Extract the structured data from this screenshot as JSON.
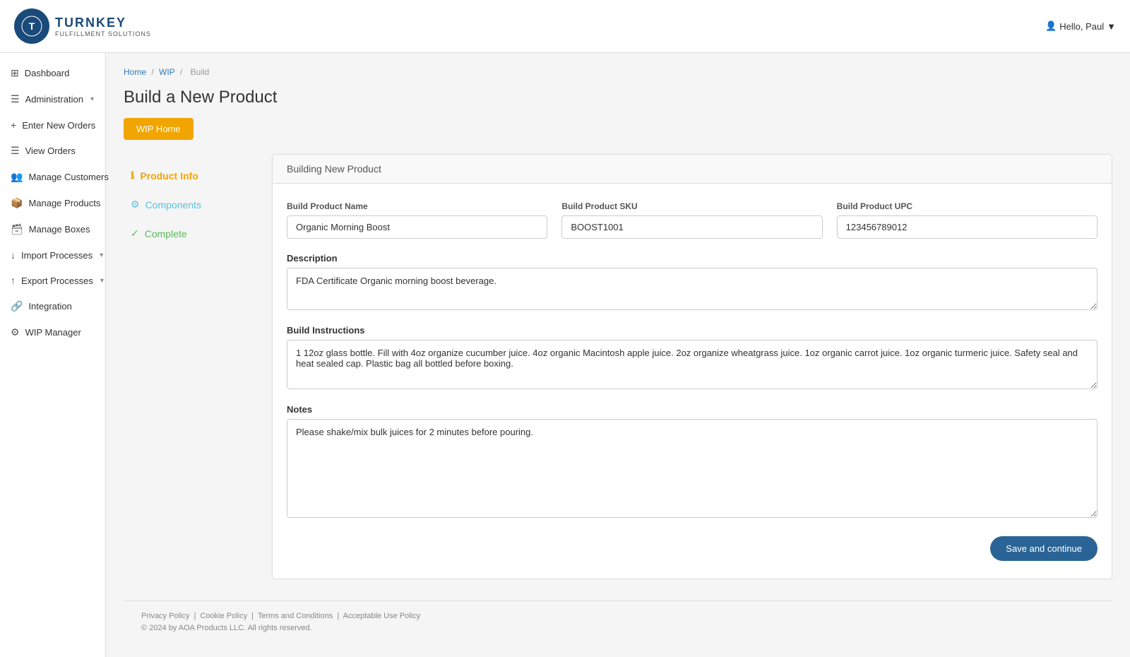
{
  "topbar": {
    "logo_letter": "T",
    "logo_title": "TURNKEY",
    "logo_subtitle": "FULFILLMENT SOLUTIONS",
    "user_label": "Hello, Paul",
    "user_arrow": "▼"
  },
  "sidebar": {
    "items": [
      {
        "id": "dashboard",
        "label": "Dashboard",
        "icon": "⊞",
        "has_arrow": false
      },
      {
        "id": "administration",
        "label": "Administration",
        "icon": "☰",
        "has_arrow": true
      },
      {
        "id": "enter-orders",
        "label": "Enter New Orders",
        "icon": "+",
        "has_arrow": false
      },
      {
        "id": "view-orders",
        "label": "View Orders",
        "icon": "☰",
        "has_arrow": false
      },
      {
        "id": "manage-customers",
        "label": "Manage Customers",
        "icon": "👥",
        "has_arrow": false
      },
      {
        "id": "manage-products",
        "label": "Manage Products",
        "icon": "📦",
        "has_arrow": false
      },
      {
        "id": "manage-boxes",
        "label": "Manage Boxes",
        "icon": "🗃",
        "has_arrow": false
      },
      {
        "id": "import-processes",
        "label": "Import Processes",
        "icon": "↓",
        "has_arrow": true
      },
      {
        "id": "export-processes",
        "label": "Export Processes",
        "icon": "↑",
        "has_arrow": true
      },
      {
        "id": "integration",
        "label": "Integration",
        "icon": "🔗",
        "has_arrow": false
      },
      {
        "id": "wip-manager",
        "label": "WIP Manager",
        "icon": "⚙",
        "has_arrow": false
      }
    ]
  },
  "breadcrumb": {
    "items": [
      "Home",
      "WIP",
      "Build"
    ],
    "separators": [
      "/",
      "/"
    ]
  },
  "page": {
    "title": "Build a New Product",
    "wip_home_label": "WIP Home"
  },
  "steps": [
    {
      "id": "product-info",
      "label": "Product Info",
      "icon": "ℹ",
      "state": "active"
    },
    {
      "id": "components",
      "label": "Components",
      "icon": "⚙",
      "state": "inactive"
    },
    {
      "id": "complete",
      "label": "Complete",
      "icon": "✓",
      "state": "complete"
    }
  ],
  "form": {
    "panel_header": "Building New Product",
    "fields": {
      "name_label": "Build Product Name",
      "name_value": "Organic Morning Boost",
      "sku_label": "Build Product SKU",
      "sku_value": "BOOST1001",
      "upc_label": "Build Product UPC",
      "upc_value": "123456789012"
    },
    "description": {
      "label": "Description",
      "value": "FDA Certificate Organic morning boost beverage."
    },
    "instructions": {
      "label": "Build Instructions",
      "value": "1 12oz glass bottle. Fill with 4oz organize cucumber juice. 4oz organic Macintosh apple juice. 2oz organize wheatgrass juice. 1oz organic carrot juice. 1oz organic turmeric juice. Safety seal and heat sealed cap. Plastic bag all bottled before boxing."
    },
    "notes": {
      "label": "Notes",
      "value": "Please shake/mix bulk juices for 2 minutes before pouring."
    },
    "save_label": "Save and continue"
  },
  "footer": {
    "links": [
      "Privacy Policy",
      "Cookie Policy",
      "Terms and Conditions",
      "Acceptable Use Policy"
    ],
    "copyright": "© 2024 by AOA Products LLC. All rights reserved."
  }
}
